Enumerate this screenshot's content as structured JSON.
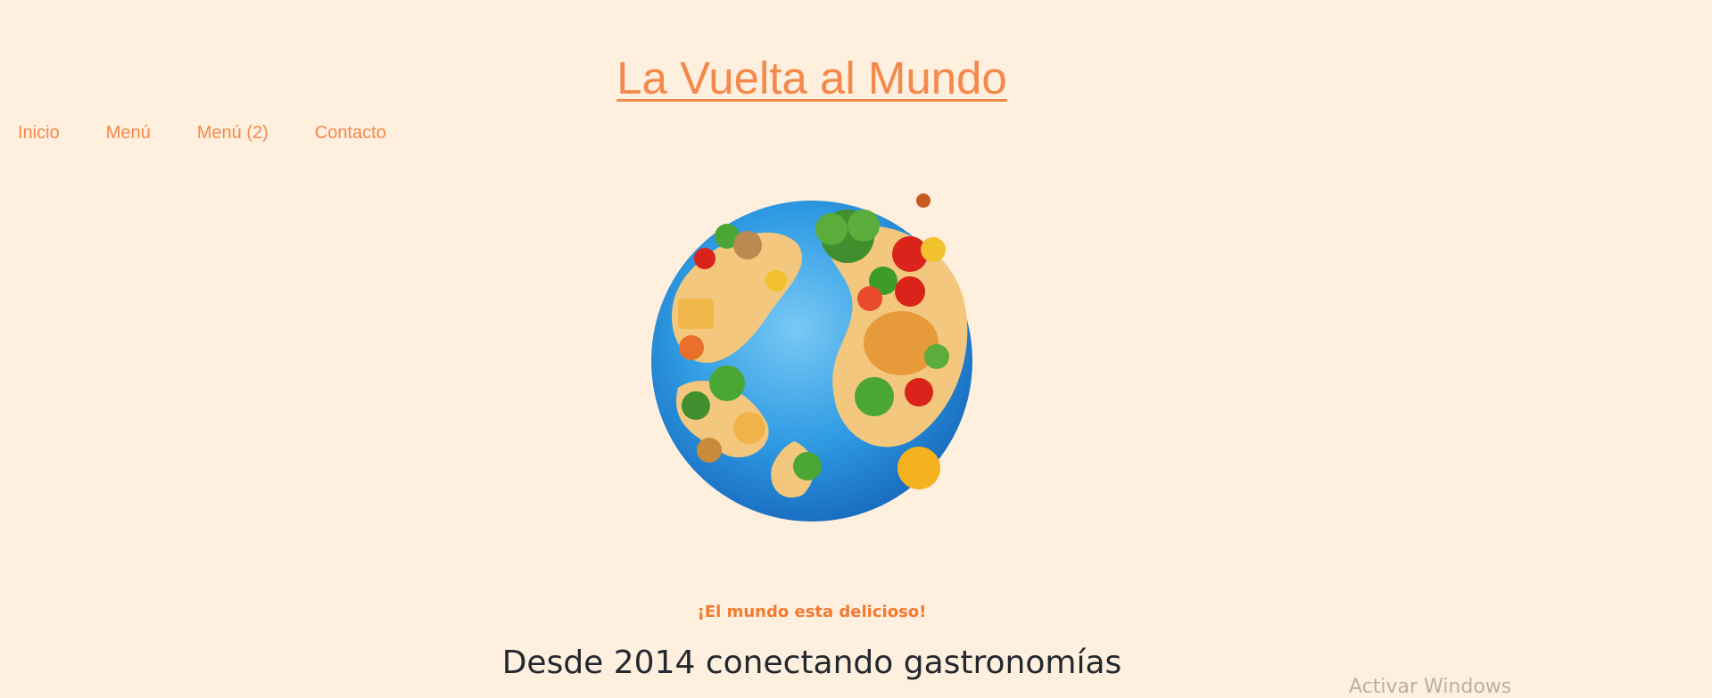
{
  "site": {
    "title": "La Vuelta al Mundo"
  },
  "nav": {
    "items": [
      "Inicio",
      "Menú",
      "Menú (2)",
      "Contacto"
    ]
  },
  "hero": {
    "image_alt": "globe-of-food",
    "tagline": "¡El mundo esta delicioso!",
    "heading": "Desde 2014 conectando gastronomías"
  },
  "overlay": {
    "watermark": "Activar Windows"
  },
  "colors": {
    "background": "#ffefde",
    "accent": "#f3894a",
    "ocean": "#2f9be3",
    "land": "#f3c77d",
    "heading": "#23272e"
  }
}
